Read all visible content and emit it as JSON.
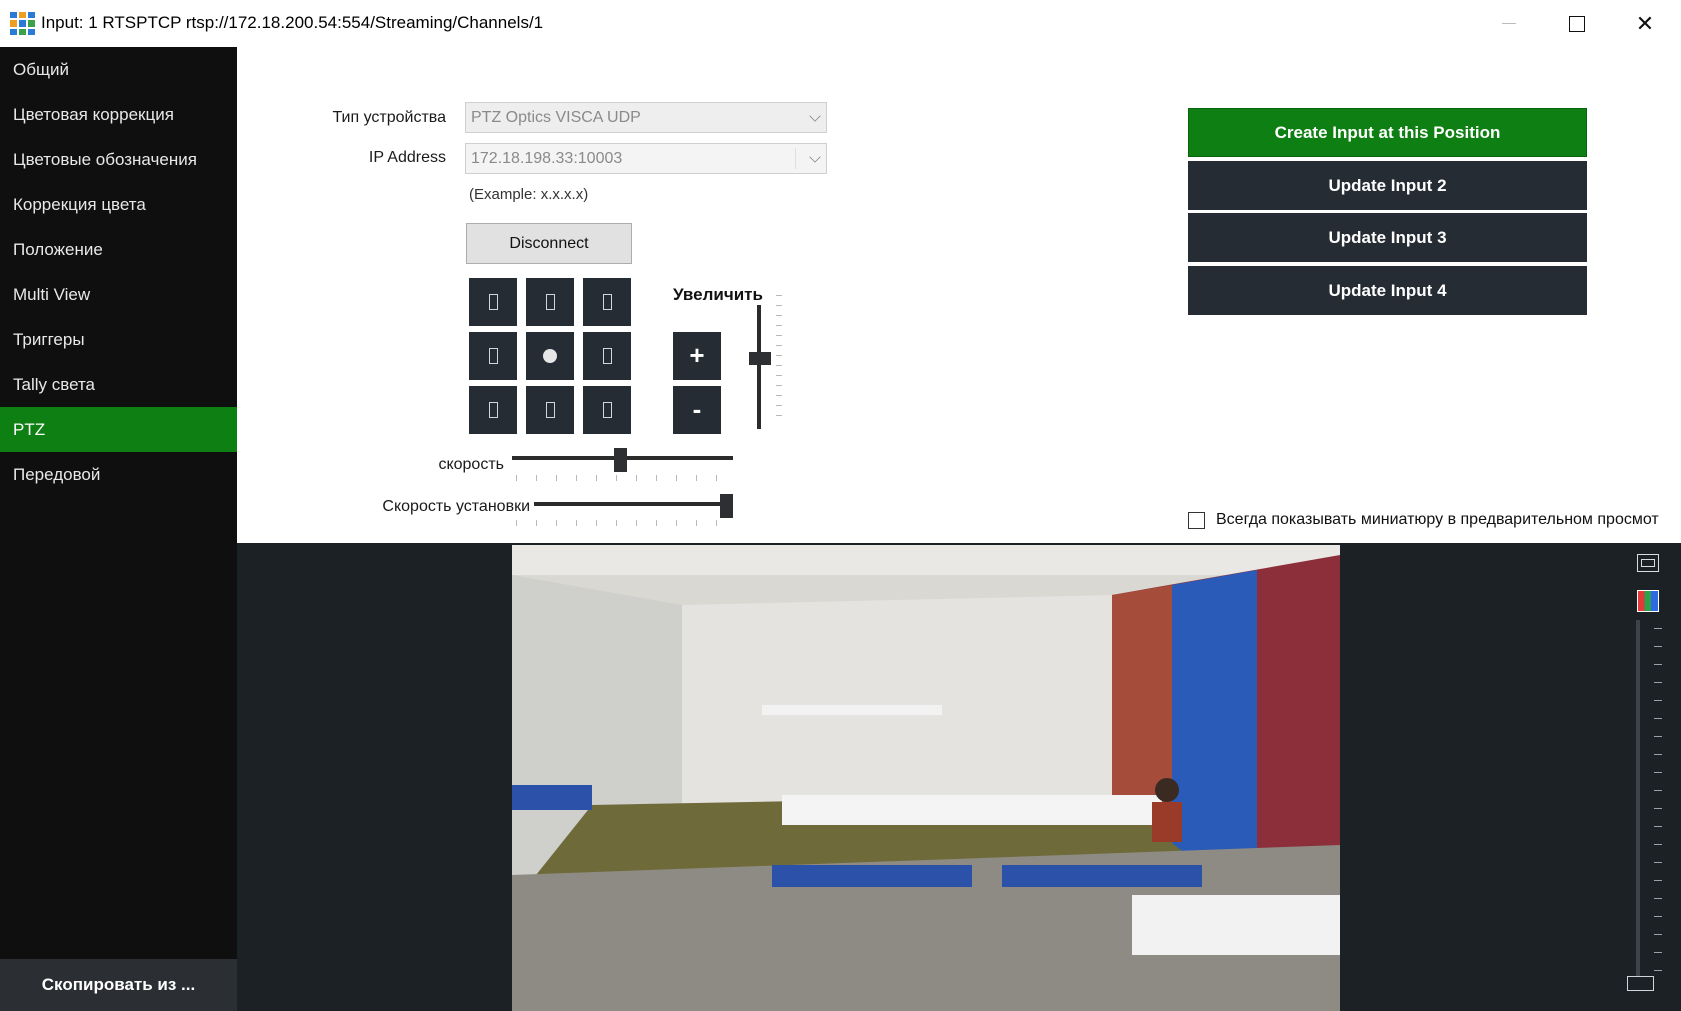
{
  "window": {
    "title": "Input: 1 RTSPTCP rtsp://172.18.200.54:554/Streaming/Channels/1"
  },
  "sidebar": {
    "items": [
      {
        "label": "Общий"
      },
      {
        "label": "Цветовая коррекция"
      },
      {
        "label": "Цветовые обозначения"
      },
      {
        "label": "Коррекция цвета"
      },
      {
        "label": "Положение"
      },
      {
        "label": "Multi View"
      },
      {
        "label": "Триггеры"
      },
      {
        "label": "Tally света"
      },
      {
        "label": "PTZ",
        "active": true
      },
      {
        "label": "Передовой"
      }
    ],
    "copy_button": "Скопировать из ..."
  },
  "ptz": {
    "device_type_label": "Тип устройства",
    "device_type_value": "PTZ Optics VISCA UDP",
    "ip_label": "IP Address",
    "ip_value": "172.18.198.33:10003",
    "ip_example": "(Example: x.x.x.x)",
    "disconnect_label": "Disconnect",
    "zoom_label": "Увеличить",
    "zoom_in": "+",
    "zoom_out": "-",
    "speed_label": "скорость",
    "preset_speed_label": "Скорость установки",
    "speed_value": 0.5,
    "preset_speed_value": 1.0,
    "zoom_value": 0.55
  },
  "presets": {
    "create_label": "Create Input at this Position",
    "update_buttons": [
      "Update Input 2",
      "Update Input 3",
      "Update Input 4"
    ]
  },
  "preview": {
    "thumbnail_checkbox_label": "Всегда показывать миниатюру в предварительном просмот",
    "thumbnail_checked": false
  },
  "colors": {
    "accent_green": "#0e7f12",
    "button_dark": "#262c33",
    "sidebar_bg": "#0f0f10",
    "preview_bg": "#1c2126"
  }
}
